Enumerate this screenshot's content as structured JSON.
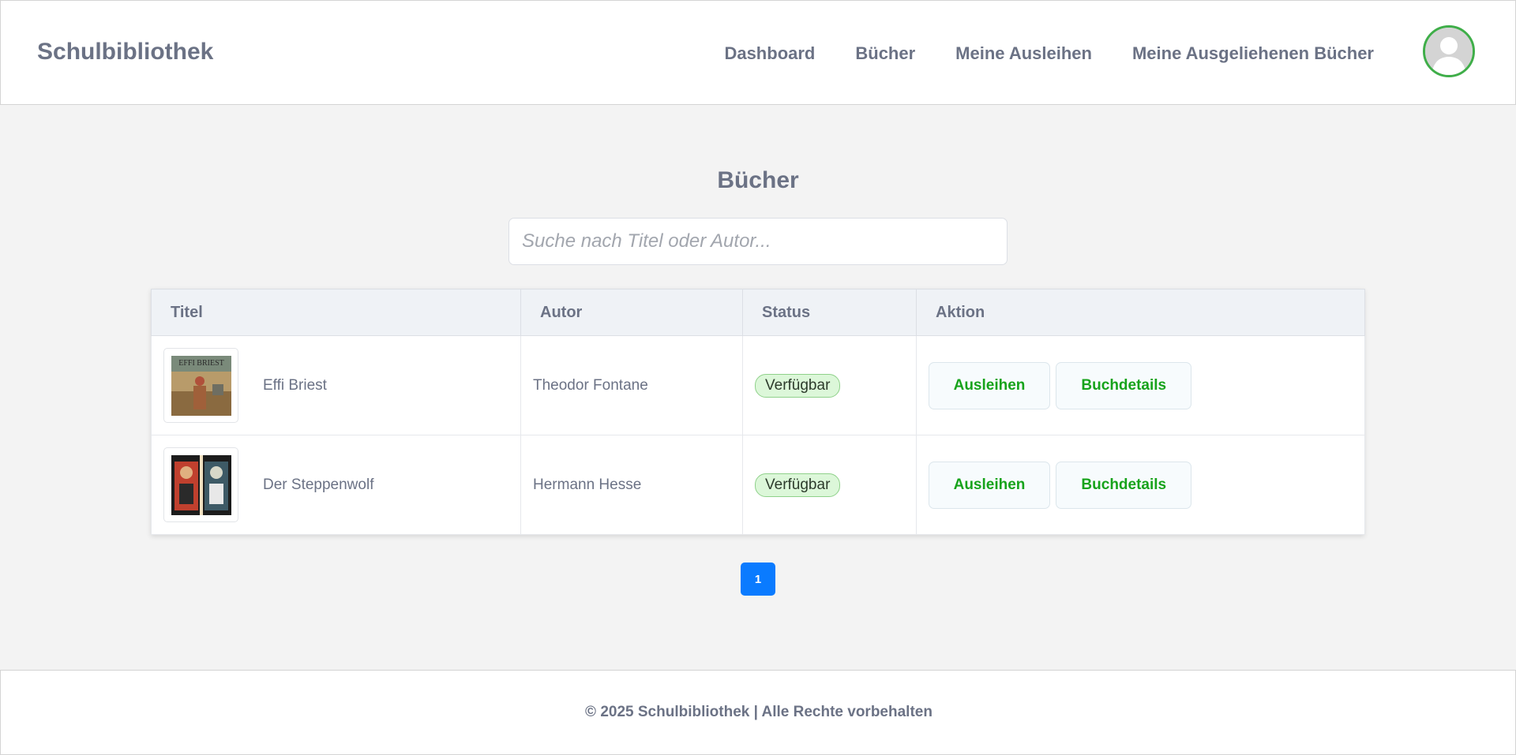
{
  "header": {
    "brand": "Schulbibliothek",
    "nav": [
      "Dashboard",
      "Bücher",
      "Meine Ausleihen",
      "Meine Ausgeliehenen Bücher"
    ]
  },
  "main": {
    "title": "Bücher",
    "search": {
      "placeholder": "Suche nach Titel oder Autor...",
      "value": ""
    },
    "table": {
      "headers": [
        "Titel",
        "Autor",
        "Status",
        "Aktion"
      ],
      "rows": [
        {
          "title": "Effi Briest",
          "author": "Theodor Fontane",
          "status": "Verfügbar",
          "borrow": "Ausleihen",
          "details": "Buchdetails"
        },
        {
          "title": "Der Steppenwolf",
          "author": "Hermann Hesse",
          "status": "Verfügbar",
          "borrow": "Ausleihen",
          "details": "Buchdetails"
        }
      ]
    },
    "pagination": {
      "current": "1"
    }
  },
  "footer": {
    "text": "© 2025 Schulbibliothek | Alle Rechte vorbehalten"
  },
  "colors": {
    "accent": "#0a7bff",
    "action_green": "#17a31b",
    "status_bg": "#dcf7d9",
    "avatar_ring": "#3fae49"
  },
  "icons": {
    "avatar": "user-avatar-icon",
    "cover_1": "book-cover-image",
    "cover_2": "book-cover-image"
  }
}
